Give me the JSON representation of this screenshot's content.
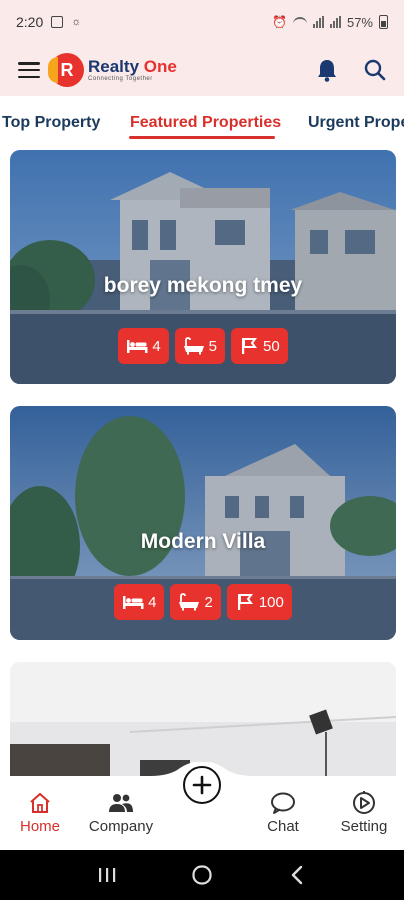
{
  "status_bar": {
    "time": "2:20",
    "battery": "57%"
  },
  "header": {
    "app_name_part1": "Realty",
    "app_name_part2": "One",
    "tagline": "Connecting Together",
    "logo_letter": "R"
  },
  "tabs": [
    {
      "label": "Top Property",
      "active": false
    },
    {
      "label": "Featured Properties",
      "active": true
    },
    {
      "label": "Urgent Properties",
      "active": false
    }
  ],
  "properties": [
    {
      "title": "borey mekong tmey",
      "beds": "4",
      "baths": "5",
      "area": "50"
    },
    {
      "title": "Modern Villa",
      "beds": "4",
      "baths": "2",
      "area": "100"
    },
    {
      "title": "",
      "beds": "",
      "baths": "",
      "area": ""
    }
  ],
  "bottom_nav": {
    "home": "Home",
    "company": "Company",
    "chat": "Chat",
    "setting": "Setting"
  },
  "colors": {
    "accent": "#e7322d",
    "header_bg": "#fbeaea",
    "tab_text": "#1b3a5c"
  }
}
